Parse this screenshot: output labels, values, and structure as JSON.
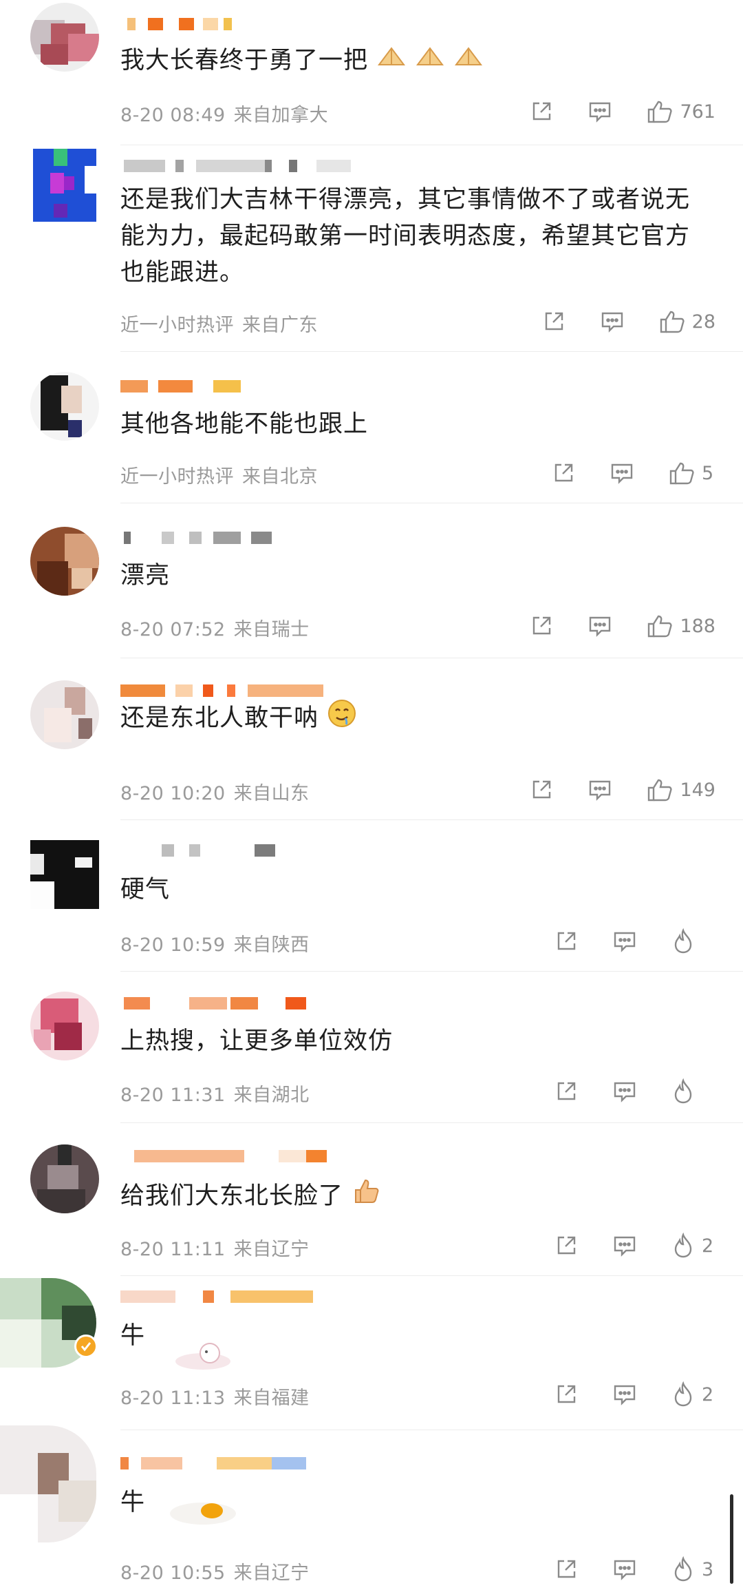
{
  "comments": [
    {
      "text": "我大长春终于勇了一把",
      "time": "8-20 08:49",
      "location": "来自加拿大",
      "action_type": "like",
      "count": "761"
    },
    {
      "text": "还是我们大吉林干得漂亮，其它事情做不了或者说无能为力，最起码敢第一时间表明态度，希望其它官方也能跟进。",
      "time": "近一小时热评",
      "location": "来自广东",
      "action_type": "like",
      "count": "28"
    },
    {
      "text": "其他各地能不能也跟上",
      "time": "近一小时热评",
      "location": "来自北京",
      "action_type": "like",
      "count": "5"
    },
    {
      "text": "漂亮",
      "time": "8-20 07:52",
      "location": "来自瑞士",
      "action_type": "like",
      "count": "188"
    },
    {
      "text": "还是东北人敢干呐",
      "time": "8-20 10:20",
      "location": "来自山东",
      "action_type": "like",
      "count": "149"
    },
    {
      "text": "硬气",
      "time": "8-20 10:59",
      "location": "来自陕西",
      "action_type": "fire",
      "count": ""
    },
    {
      "text": "上热搜，让更多单位效仿",
      "time": "8-20 11:31",
      "location": "来自湖北",
      "action_type": "fire",
      "count": ""
    },
    {
      "text": "给我们大东北长脸了",
      "time": "8-20 11:11",
      "location": "来自辽宁",
      "action_type": "fire",
      "count": "2"
    },
    {
      "text": "牛",
      "time": "8-20 11:13",
      "location": "来自福建",
      "action_type": "fire",
      "count": "2"
    },
    {
      "text": "牛",
      "time": "8-20 10:55",
      "location": "来自辽宁",
      "action_type": "fire",
      "count": "3"
    }
  ],
  "icons": {
    "share": "share-icon",
    "reply": "comment-icon",
    "like": "thumbs-up-icon",
    "fire": "fire-icon",
    "pray": "folded-hands-emoji",
    "drool": "drooling-face-emoji",
    "thumb": "thumbs-up-emoji",
    "verified": "verified-badge-icon"
  },
  "colors": {
    "text": "#1f1f1f",
    "meta": "#9a9a9a",
    "icon": "#8a8a8a",
    "verified": "#f5a623"
  }
}
